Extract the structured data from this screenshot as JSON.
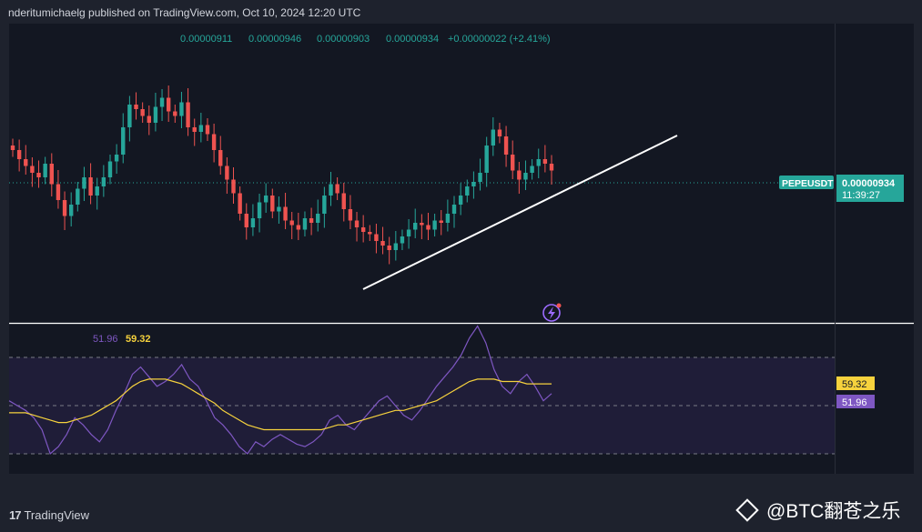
{
  "header": {
    "publisher_line": "nderitumichaelg published on TradingView.com, Oct 10, 2024 12:20 UTC"
  },
  "ohlc_line": {
    "open": "0.00000911",
    "high": "0.00000946",
    "low": "0.00000903",
    "close": "0.00000934",
    "change": "+0.00000022 (+2.41%)"
  },
  "price_badge": {
    "symbol": "PEPEUSDT",
    "price": "0.00000934",
    "countdown": "11:39:27"
  },
  "rsi_panel": {
    "rsi_value": "51.96",
    "ma_value": "59.32"
  },
  "footer": {
    "logo_text": "TradingView",
    "watermark": "@BTC翻苍之乐"
  },
  "colors": {
    "background": "#1e222d",
    "up_candle": "#26a69a",
    "down_candle": "#ef5350",
    "rsi_line": "#7e57c2",
    "rsi_ma_line": "#f6d23d",
    "trendline": "#ffffff"
  },
  "chart_data": [
    {
      "type": "candlestick",
      "symbol": "PEPEUSDT",
      "open_high_low_close_shown": [
        9.11e-06,
        9.46e-06,
        9.03e-06,
        9.34e-06
      ],
      "last_price": 9.34e-06,
      "trendline": "ascending support line drawn under recent lows",
      "candles_relative_close": [
        0.62,
        0.58,
        0.55,
        0.52,
        0.5,
        0.56,
        0.47,
        0.4,
        0.33,
        0.38,
        0.45,
        0.5,
        0.42,
        0.46,
        0.5,
        0.57,
        0.6,
        0.72,
        0.82,
        0.8,
        0.77,
        0.74,
        0.81,
        0.85,
        0.79,
        0.77,
        0.83,
        0.72,
        0.7,
        0.73,
        0.69,
        0.62,
        0.55,
        0.49,
        0.43,
        0.34,
        0.28,
        0.32,
        0.39,
        0.42,
        0.35,
        0.37,
        0.31,
        0.29,
        0.27,
        0.32,
        0.3,
        0.34,
        0.42,
        0.47,
        0.43,
        0.36,
        0.31,
        0.28,
        0.26,
        0.25,
        0.22,
        0.2,
        0.18,
        0.21,
        0.24,
        0.27,
        0.3,
        0.29,
        0.27,
        0.31,
        0.3,
        0.34,
        0.38,
        0.42,
        0.46,
        0.48,
        0.52,
        0.64,
        0.71,
        0.68,
        0.6,
        0.53,
        0.49,
        0.52,
        0.55,
        0.58,
        0.56,
        0.53
      ],
      "ylim_relative": [
        0,
        1
      ]
    },
    {
      "type": "line",
      "name": "RSI",
      "series": [
        {
          "name": "RSI",
          "values": [
            52,
            50,
            48,
            45,
            40,
            30,
            33,
            38,
            45,
            42,
            38,
            35,
            40,
            48,
            55,
            63,
            66,
            62,
            58,
            60,
            63,
            67,
            61,
            58,
            52,
            45,
            42,
            38,
            33,
            30,
            35,
            33,
            36,
            38,
            36,
            34,
            33,
            35,
            38,
            44,
            46,
            42,
            40,
            44,
            48,
            52,
            54,
            50,
            46,
            44,
            48,
            53,
            58,
            62,
            66,
            71,
            78,
            83,
            76,
            65,
            58,
            55,
            60,
            63,
            58,
            52,
            55
          ]
        },
        {
          "name": "MA",
          "values": [
            47,
            47,
            47,
            46,
            45,
            44,
            43,
            43,
            44,
            45,
            46,
            48,
            50,
            52,
            55,
            58,
            60,
            61,
            61,
            61,
            60,
            59,
            57,
            55,
            53,
            51,
            48,
            46,
            44,
            42,
            41,
            40,
            40,
            40,
            40,
            40,
            40,
            40,
            40,
            41,
            42,
            42,
            43,
            44,
            45,
            46,
            47,
            48,
            48,
            49,
            50,
            51,
            52,
            54,
            56,
            58,
            60,
            61,
            61,
            61,
            60,
            60,
            60,
            59,
            59,
            59,
            59
          ]
        }
      ],
      "last_values": {
        "RSI": 51.96,
        "MA": 59.32
      },
      "ylim": [
        0,
        100
      ],
      "guide_levels": [
        70,
        50,
        30
      ]
    }
  ]
}
